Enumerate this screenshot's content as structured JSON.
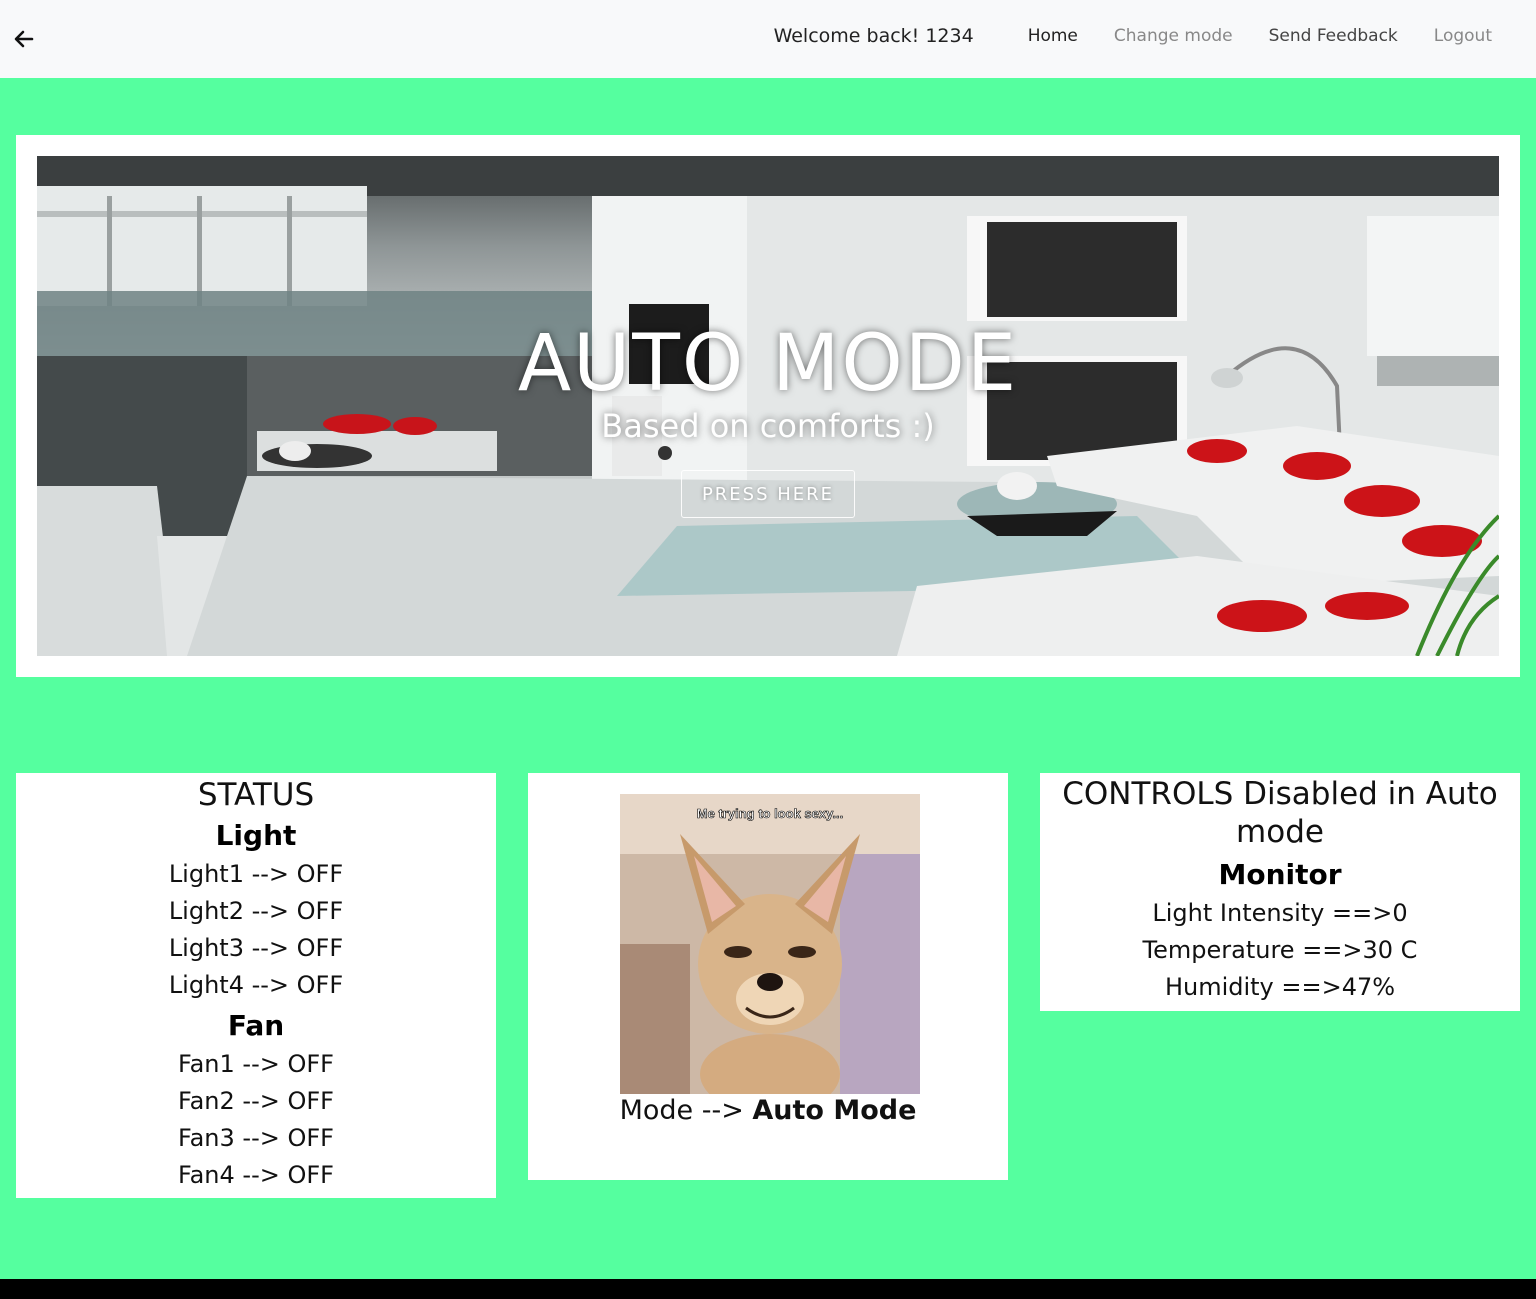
{
  "navbar": {
    "welcome": "Welcome back! 1234",
    "links": [
      {
        "label": "Home"
      },
      {
        "label": "Change mode"
      },
      {
        "label": "Send Feedback"
      },
      {
        "label": "Logout"
      }
    ]
  },
  "hero": {
    "title": "AUTO MODE",
    "subtitle": "Based on comforts :)",
    "button": "PRESS HERE"
  },
  "status": {
    "title": "STATUS",
    "light_heading": "Light",
    "lights": [
      "Light1 --> OFF",
      "Light2 --> OFF",
      "Light3 --> OFF",
      "Light4 --> OFF"
    ],
    "fan_heading": "Fan",
    "fans": [
      "Fan1 --> OFF",
      "Fan2 --> OFF",
      "Fan3 --> OFF",
      "Fan4 --> OFF"
    ]
  },
  "mode": {
    "meme_caption": "Me trying to look sexy...",
    "prefix": "Mode --> ",
    "value": "Auto Mode"
  },
  "controls": {
    "title": "CONTROLS Disabled in Auto mode",
    "monitor_heading": "Monitor",
    "rows": [
      "Light Intensity ==>0",
      "Temperature ==>30 C",
      "Humidity ==>47%"
    ]
  },
  "colors": {
    "page_background": "#55ff9f",
    "navbar_background": "#f8f9fa",
    "footer": "#000000"
  }
}
